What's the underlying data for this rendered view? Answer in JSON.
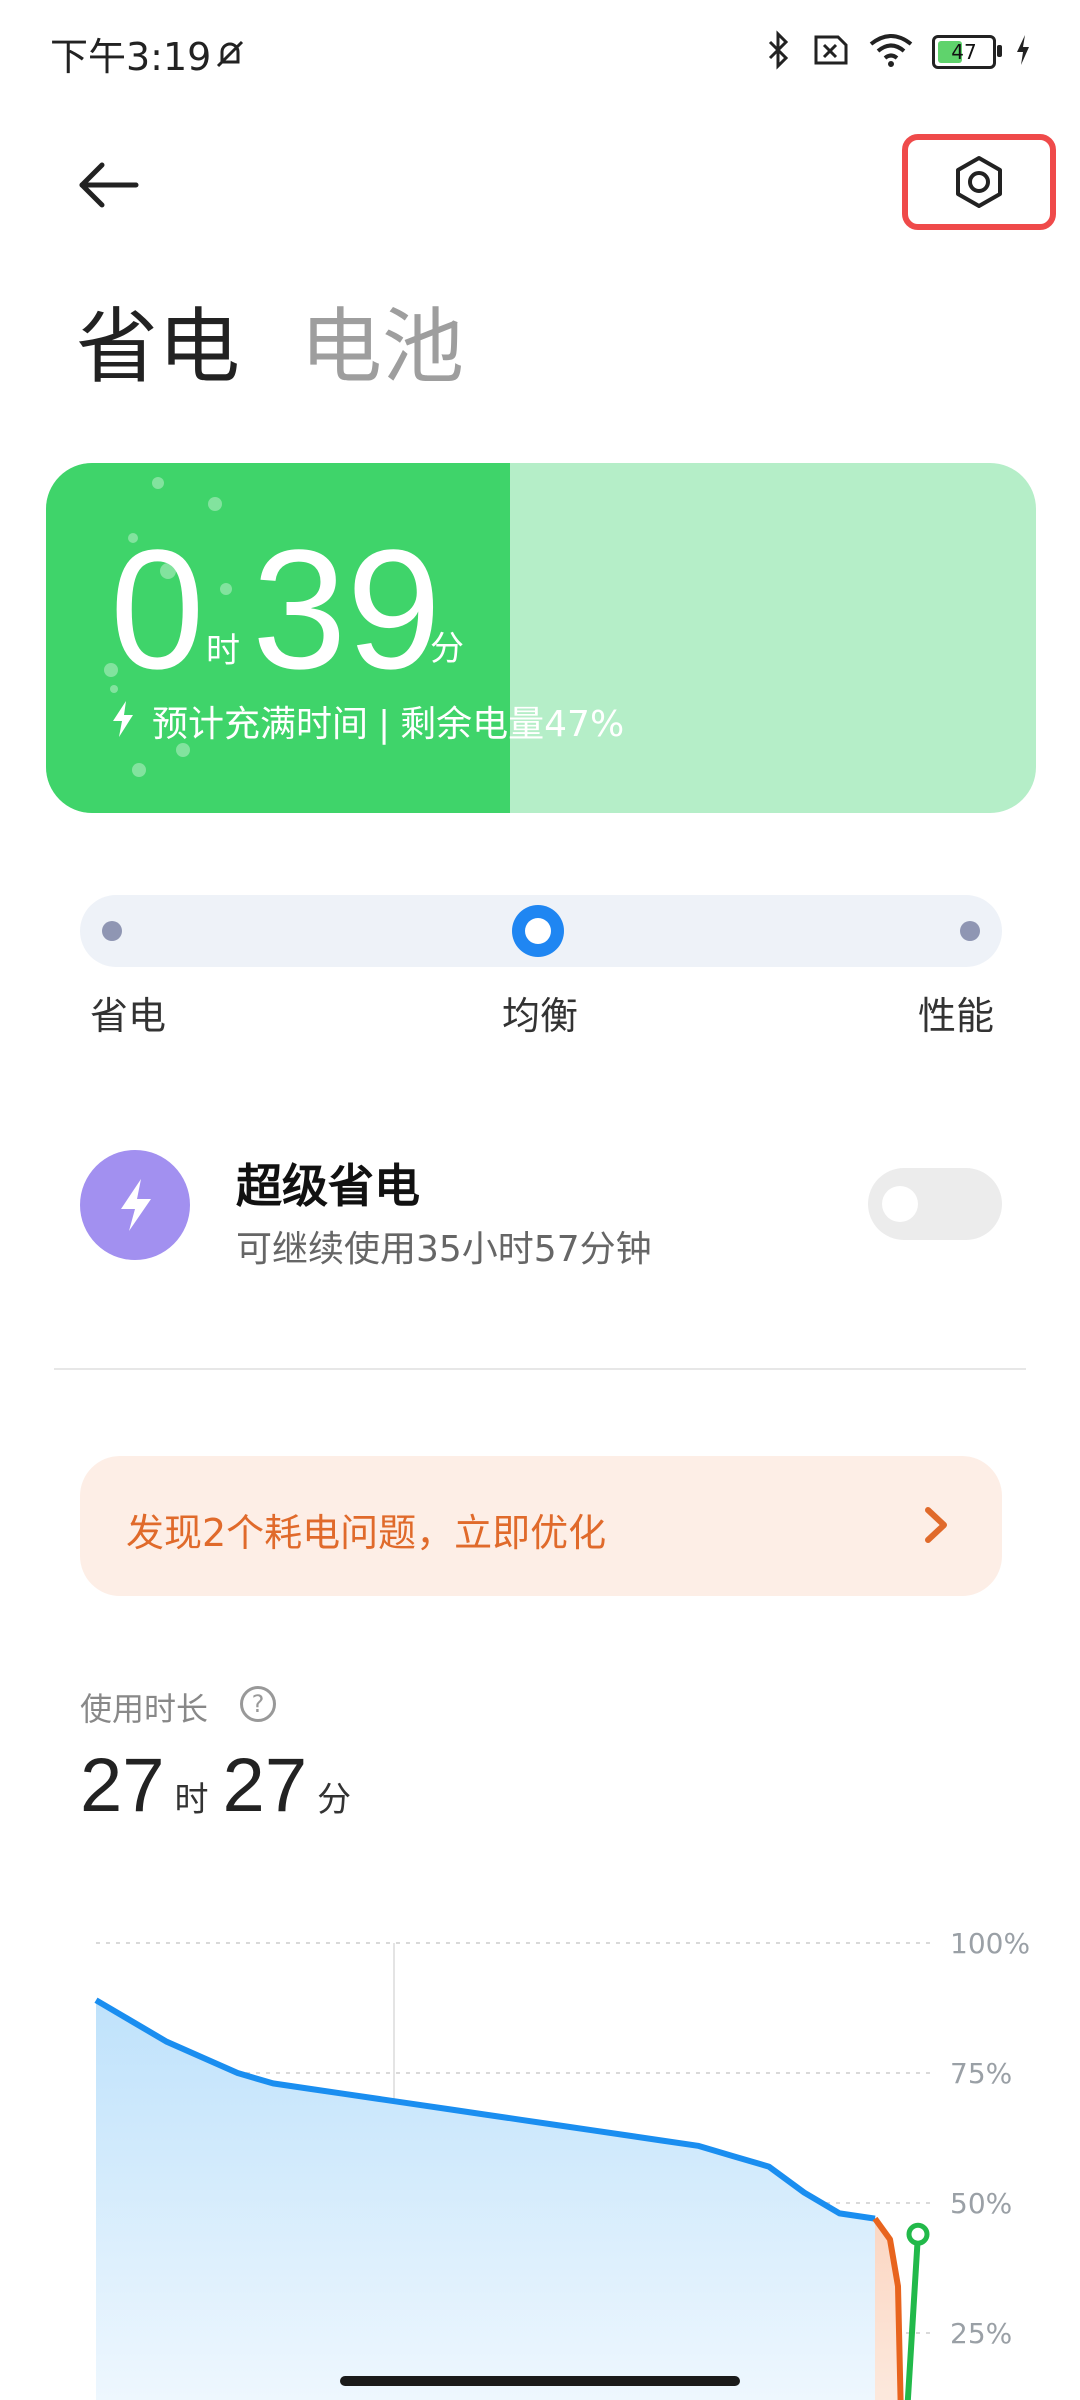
{
  "status": {
    "time": "下午3:19",
    "battery_level": "47"
  },
  "header": {
    "tab_active": "省电",
    "tab_inactive": "电池"
  },
  "hero": {
    "hours": "0",
    "hours_unit": "时",
    "minutes": "39",
    "minutes_unit": "分",
    "charge_label": "预计充满时间",
    "separator": "|",
    "remaining_label": "剩余电量47%",
    "level_fraction": 0.47
  },
  "mode": {
    "options": [
      "省电",
      "均衡",
      "性能"
    ],
    "selected": "均衡"
  },
  "super_saver": {
    "title": "超级省电",
    "subtitle": "可继续使用35小时57分钟",
    "enabled": false
  },
  "banner": {
    "text": "发现2个耗电问题，立即优化"
  },
  "usage": {
    "label": "使用时长",
    "hours": "27",
    "hours_unit": "时",
    "minutes": "27",
    "minutes_unit": "分"
  },
  "chart_data": {
    "type": "line",
    "y_ticks": [
      "100%",
      "75%",
      "50%",
      "25%"
    ],
    "ylim": [
      0,
      100
    ],
    "series": [
      {
        "color": "#1a8ef0",
        "values": [
          89,
          85,
          81,
          78,
          75,
          73,
          72,
          71,
          70,
          69,
          68,
          67,
          66,
          65,
          64,
          63,
          62,
          61,
          59,
          57,
          52,
          48,
          47
        ]
      },
      {
        "color": "#e8641e",
        "values": [
          47,
          43,
          34,
          0
        ]
      },
      {
        "color": "#22b94a",
        "values": [
          0,
          44
        ]
      }
    ]
  }
}
